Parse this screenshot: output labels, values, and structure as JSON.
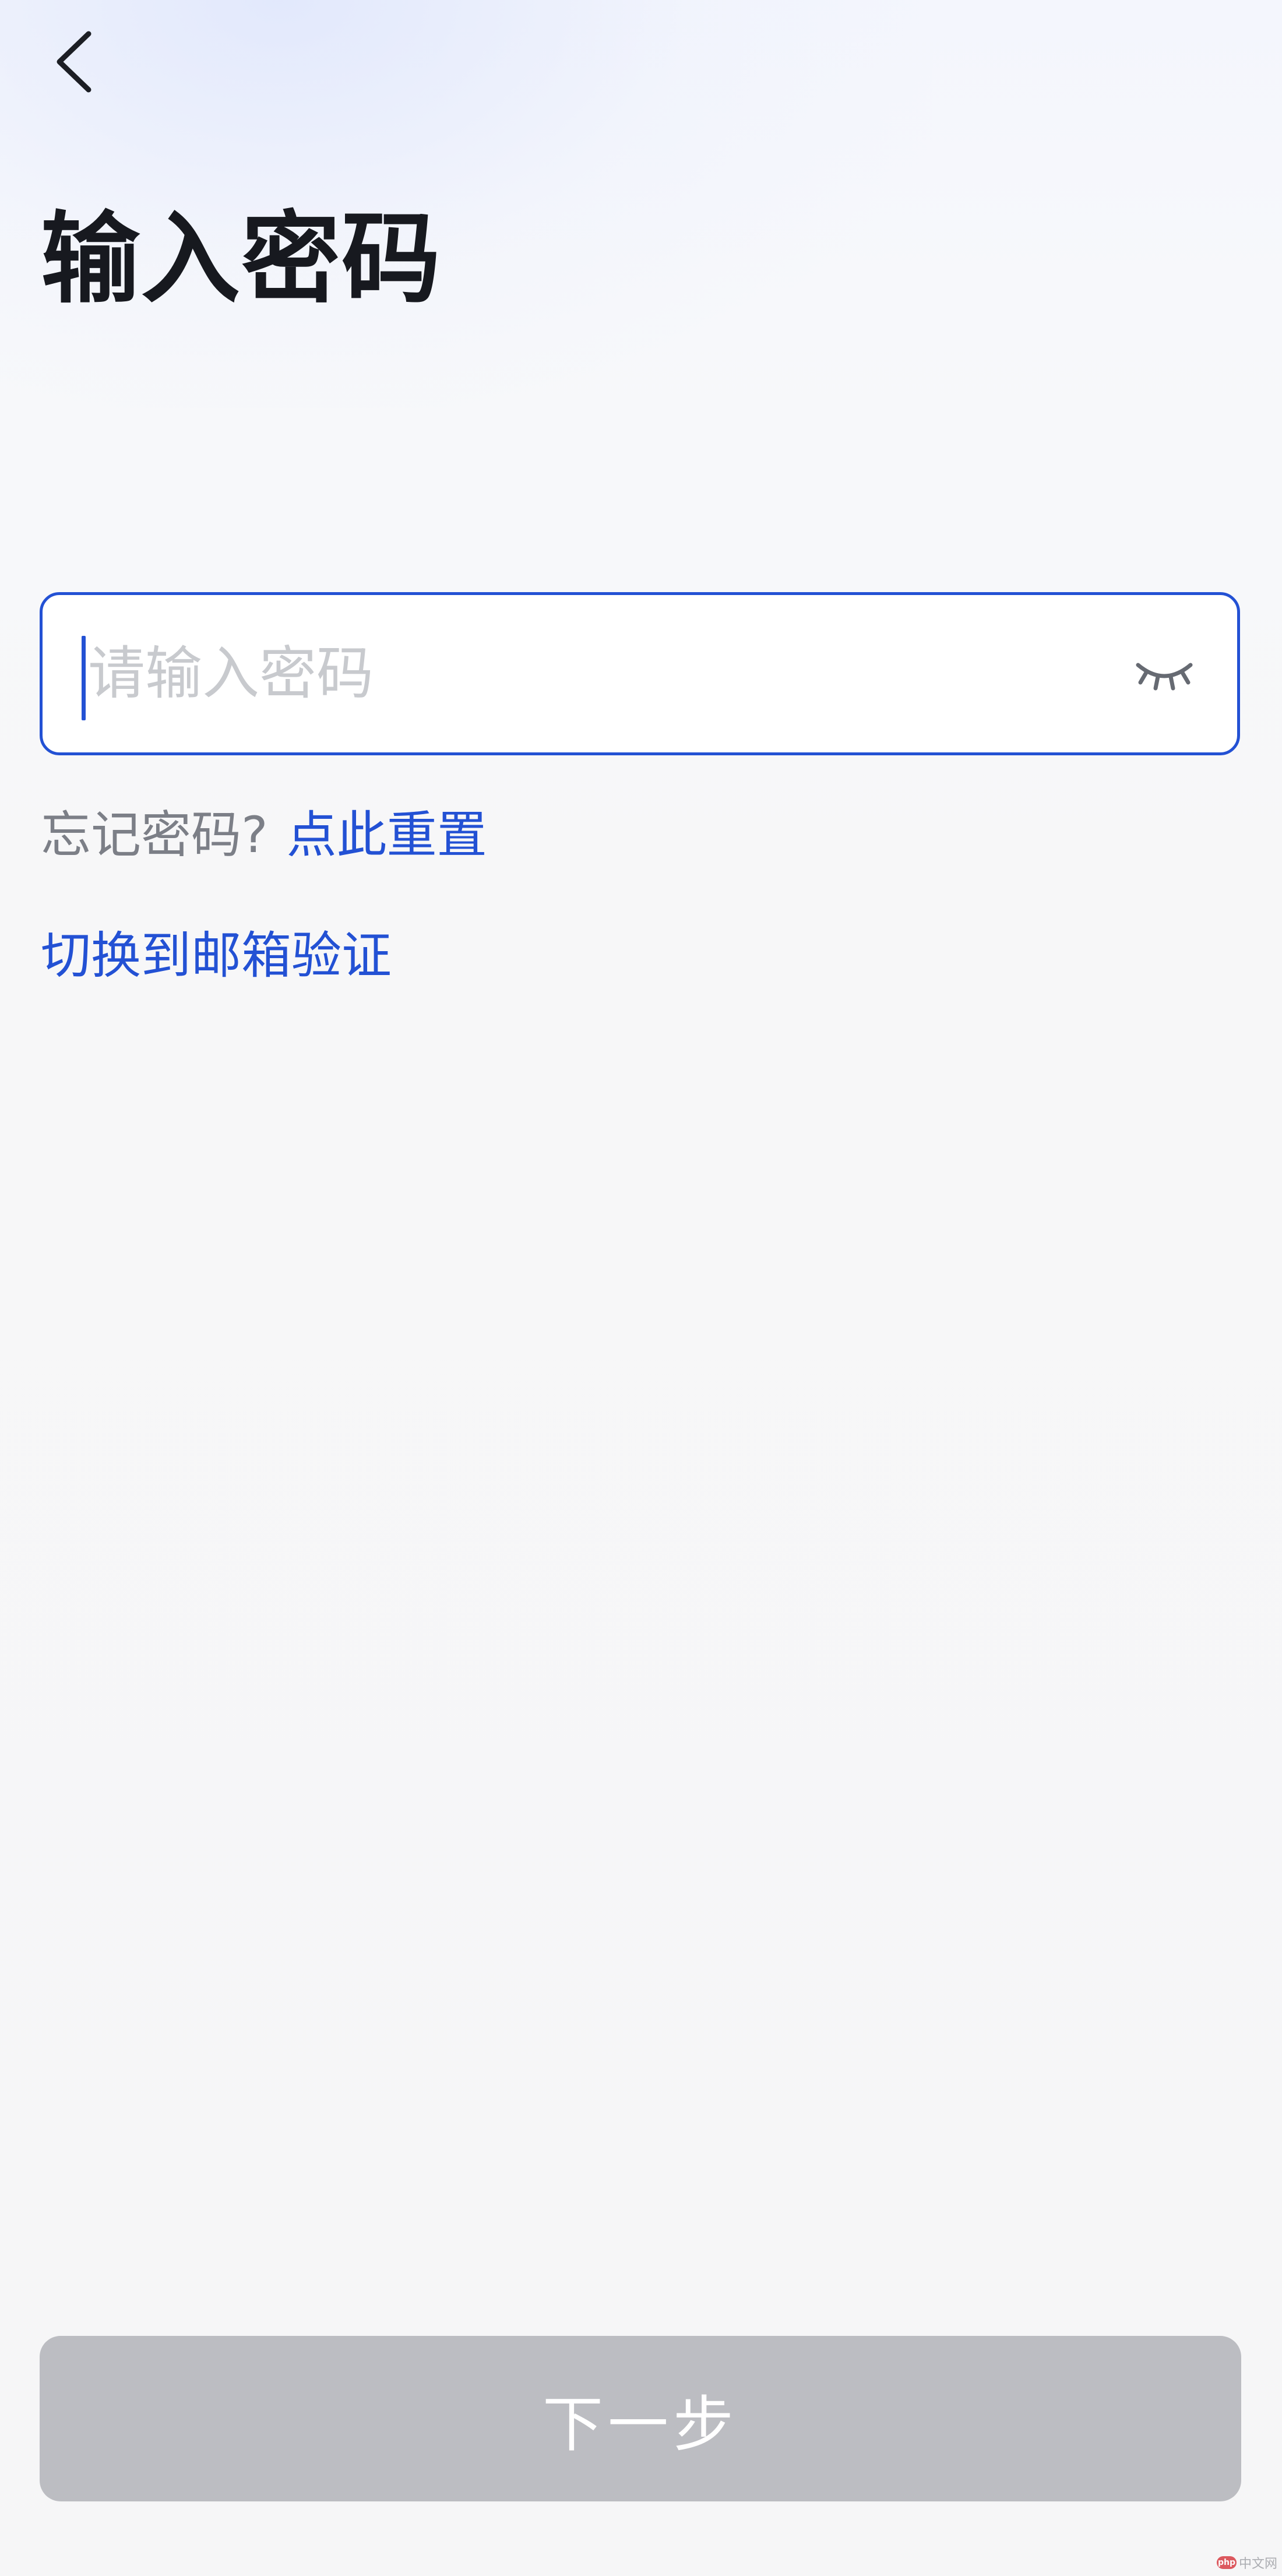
{
  "header": {
    "back_icon": "chevron-left-icon",
    "title": "输入密码"
  },
  "password_field": {
    "placeholder": "请输入密码",
    "value": "",
    "visibility_icon": "eye-closed-icon"
  },
  "forgot": {
    "prompt": "忘记密码?",
    "reset_link": "点此重置"
  },
  "switch_link": "切换到邮箱验证",
  "next_button": {
    "label": "下一步",
    "enabled": false
  },
  "watermark": {
    "logo": "php",
    "text": "中文网"
  },
  "colors": {
    "accent": "#2351d4",
    "title": "#17191f",
    "muted_text": "#7c7f87",
    "placeholder": "#c8cace",
    "disabled_button": "#bcbdc2"
  }
}
